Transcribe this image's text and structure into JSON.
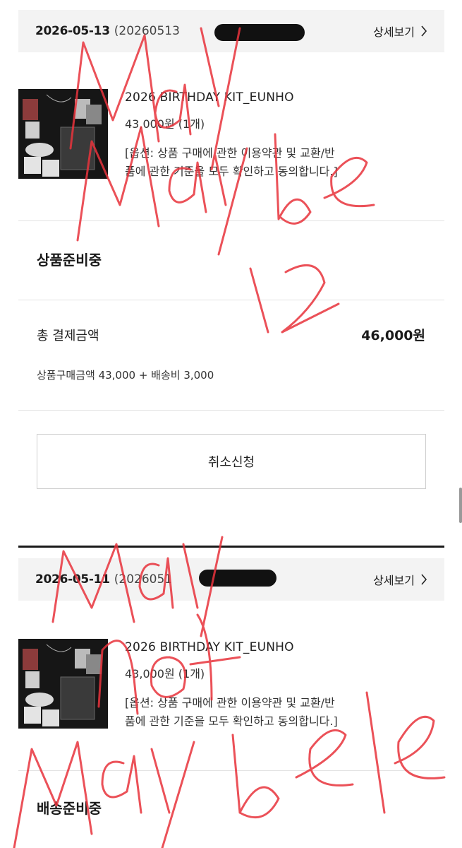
{
  "orders": [
    {
      "date": "2026-05-13",
      "order_no": "(20260513",
      "detail_label": "상세보기",
      "product_name": "2026 BIRTHDAY KIT_EUNHO",
      "price": "43,000원 (1개)",
      "option_line1": "[옵션: 상품 구매에 관한 이용약관 및 교환/반",
      "option_line2": "품에 관한 기준을 모두 확인하고 동의합니다.]",
      "status": "상품준비중",
      "total_label": "총 결제금액",
      "total_amount": "46,000원",
      "breakdown": "상품구매금액 43,000 + 배송비 3,000",
      "cancel_label": "취소신청"
    },
    {
      "date": "2026-05-11",
      "order_no": "(2026051",
      "detail_label": "상세보기",
      "product_name": "2026 BIRTHDAY KIT_EUNHO",
      "price": "43,000원 (1개)",
      "option_line1": "[옵션: 상품 구매에 관한 이용약관 및 교환/반",
      "option_line2": "품에 관한 기준을 모두 확인하고 동의합니다.]",
      "status": "배송준비중"
    }
  ],
  "handwriting": [
    "may",
    "maybe",
    "12",
    "may",
    "not",
    "maybe"
  ],
  "colors": {
    "header_bg": "#f3f3f3",
    "scribble": "#e8333c"
  }
}
